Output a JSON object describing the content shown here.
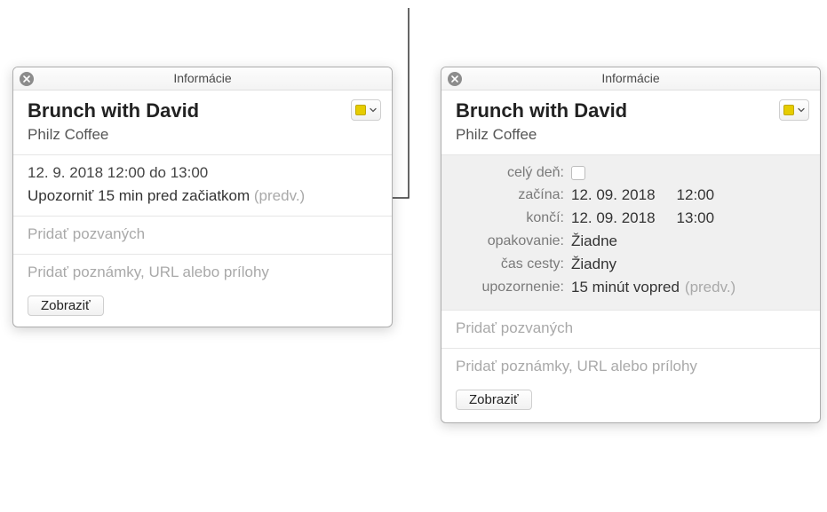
{
  "left": {
    "windowTitle": "Informácie",
    "eventTitle": "Brunch with David",
    "eventLocation": "Philz Coffee",
    "summaryDateTime": "12. 9. 2018 12:00 do 13:00",
    "summaryAlertPrefix": "Upozorniť 15 min pred začiatkom ",
    "summaryAlertDefault": "(predv.)",
    "inviteesPlaceholder": "Pridať pozvaných",
    "notesPlaceholder": "Pridať poznámky, URL alebo prílohy",
    "showButton": "Zobraziť"
  },
  "right": {
    "windowTitle": "Informácie",
    "eventTitle": "Brunch with David",
    "eventLocation": "Philz Coffee",
    "labels": {
      "allDay": "celý deň:",
      "starts": "začína:",
      "ends": "končí:",
      "repeat": "opakovanie:",
      "travel": "čas cesty:",
      "alert": "upozornenie:"
    },
    "values": {
      "startDate": "12. 09. 2018",
      "startTime": "12:00",
      "endDate": "12. 09. 2018",
      "endTime": "13:00",
      "repeat": "Žiadne",
      "travel": "Žiadny",
      "alert": "15 minút vopred",
      "alertDefault": "(predv.)"
    },
    "inviteesPlaceholder": "Pridať pozvaných",
    "notesPlaceholder": "Pridať poznámky, URL alebo prílohy",
    "showButton": "Zobraziť"
  }
}
